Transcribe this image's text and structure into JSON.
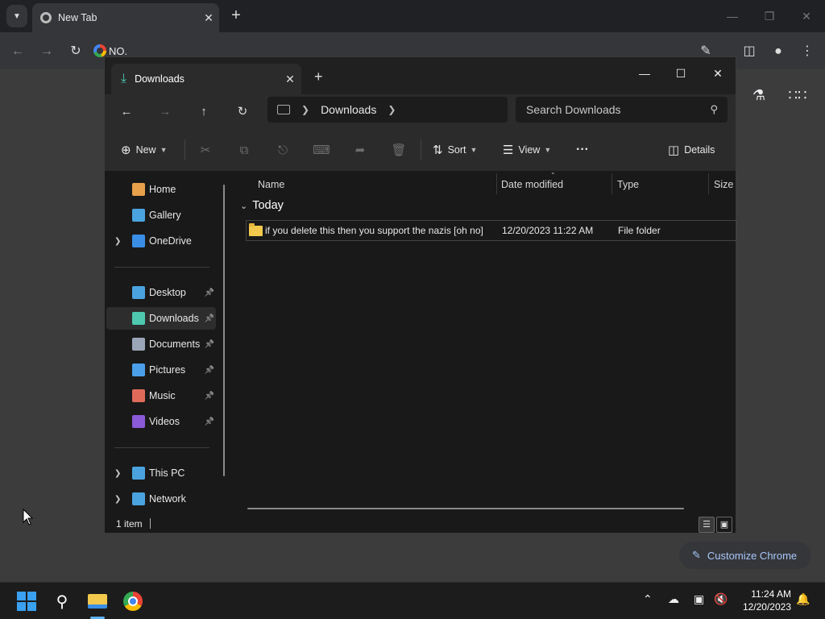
{
  "chrome": {
    "tab_title": "New Tab",
    "omnibox_text": "NO.",
    "customize_label": "Customize Chrome"
  },
  "explorer": {
    "tab_title": "Downloads",
    "breadcrumb": [
      "Downloads"
    ],
    "search_placeholder": "Search Downloads",
    "commands": {
      "new_label": "New",
      "sort_label": "Sort",
      "view_label": "View",
      "details_label": "Details",
      "more_label": "···"
    },
    "sidebar": {
      "items": [
        {
          "label": "Home",
          "icon": "home-icon",
          "color": "#e8a04a"
        },
        {
          "label": "Gallery",
          "icon": "gallery-icon",
          "color": "#4aa3df"
        },
        {
          "label": "OneDrive",
          "icon": "cloud-icon",
          "color": "#3a8ee6",
          "expandable": true
        },
        {
          "label": "Desktop",
          "icon": "desktop-icon",
          "color": "#4aa3df",
          "pinned": true
        },
        {
          "label": "Downloads",
          "icon": "download-icon",
          "color": "#4ec9b0",
          "pinned": true,
          "selected": true
        },
        {
          "label": "Documents",
          "icon": "documents-icon",
          "color": "#9aa6b8",
          "pinned": true
        },
        {
          "label": "Pictures",
          "icon": "pictures-icon",
          "color": "#4a9fe8",
          "pinned": true
        },
        {
          "label": "Music",
          "icon": "music-icon",
          "color": "#e06a5a",
          "pinned": true
        },
        {
          "label": "Videos",
          "icon": "videos-icon",
          "color": "#8a5ad8",
          "pinned": true
        },
        {
          "label": "This PC",
          "icon": "pc-icon",
          "color": "#4aa3df",
          "expandable": true
        },
        {
          "label": "Network",
          "icon": "network-icon",
          "color": "#4aa3df",
          "expandable": true
        }
      ]
    },
    "columns": {
      "name": "Name",
      "date_modified": "Date modified",
      "type": "Type",
      "size": "Size"
    },
    "group_label": "Today",
    "files": [
      {
        "name": "if you delete this then you support the nazis [oh no]",
        "date_modified": "12/20/2023 11:22 AM",
        "type": "File folder"
      }
    ],
    "status_text": "1 item"
  },
  "taskbar": {
    "time": "11:24 AM",
    "date": "12/20/2023"
  }
}
